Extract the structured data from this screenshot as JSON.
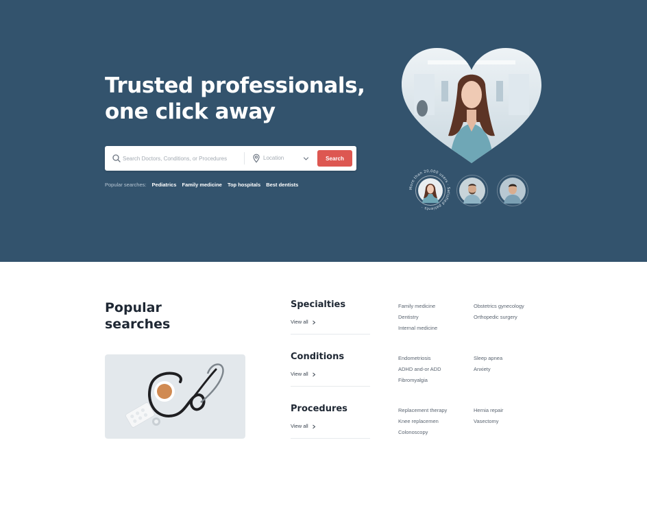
{
  "hero": {
    "title_line1": "Trusted professionals,",
    "title_line2": "one click away",
    "search": {
      "placeholder": "Search Doctors, Conditions, or Procedures",
      "location_placeholder": "Location",
      "button_label": "Search"
    },
    "popular": {
      "label": "Popular searches:",
      "chips": [
        "Pediatrics",
        "Family medicine",
        "Top hospitals",
        "Best dentists"
      ]
    },
    "ring_text": "More than 20,000 users · Satisfied patients ·"
  },
  "main": {
    "title_line1": "Popular",
    "title_line2": "searches",
    "view_all_label": "View all",
    "categories": [
      {
        "title": "Specialties",
        "col1": [
          "Family medicine",
          "Dentistry",
          "Internal medicine"
        ],
        "col2": [
          "Obstetrics gynecology",
          "Orthopedic surgery"
        ]
      },
      {
        "title": "Conditions",
        "col1": [
          "Endometriosis",
          "ADHD and-or ADD",
          "Fibromyalgia"
        ],
        "col2": [
          "Sleep apnea",
          "Anxiety"
        ]
      },
      {
        "title": "Procedures",
        "col1": [
          "Replacement therapy",
          "Knee replacemen",
          "Colonoscopy"
        ],
        "col2": [
          "Hernia repair",
          "Vasectomy"
        ]
      }
    ]
  },
  "colors": {
    "hero_bg": "#33536d",
    "accent": "#dd5751",
    "text_dark": "#1e2733",
    "text_muted": "#5a6470"
  },
  "icons": [
    "search-icon",
    "location-pin-icon",
    "chevron-down-icon",
    "chevron-right-icon"
  ]
}
